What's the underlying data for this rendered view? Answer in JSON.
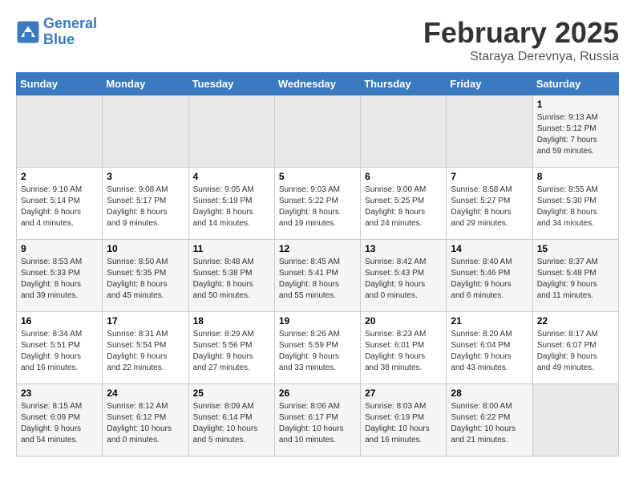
{
  "header": {
    "logo_line1": "General",
    "logo_line2": "Blue",
    "month": "February 2025",
    "location": "Staraya Derevnya, Russia"
  },
  "weekdays": [
    "Sunday",
    "Monday",
    "Tuesday",
    "Wednesday",
    "Thursday",
    "Friday",
    "Saturday"
  ],
  "weeks": [
    [
      {
        "day": "",
        "info": ""
      },
      {
        "day": "",
        "info": ""
      },
      {
        "day": "",
        "info": ""
      },
      {
        "day": "",
        "info": ""
      },
      {
        "day": "",
        "info": ""
      },
      {
        "day": "",
        "info": ""
      },
      {
        "day": "1",
        "info": "Sunrise: 9:13 AM\nSunset: 5:12 PM\nDaylight: 7 hours\nand 59 minutes."
      }
    ],
    [
      {
        "day": "2",
        "info": "Sunrise: 9:10 AM\nSunset: 5:14 PM\nDaylight: 8 hours\nand 4 minutes."
      },
      {
        "day": "3",
        "info": "Sunrise: 9:08 AM\nSunset: 5:17 PM\nDaylight: 8 hours\nand 9 minutes."
      },
      {
        "day": "4",
        "info": "Sunrise: 9:05 AM\nSunset: 5:19 PM\nDaylight: 8 hours\nand 14 minutes."
      },
      {
        "day": "5",
        "info": "Sunrise: 9:03 AM\nSunset: 5:22 PM\nDaylight: 8 hours\nand 19 minutes."
      },
      {
        "day": "6",
        "info": "Sunrise: 9:00 AM\nSunset: 5:25 PM\nDaylight: 8 hours\nand 24 minutes."
      },
      {
        "day": "7",
        "info": "Sunrise: 8:58 AM\nSunset: 5:27 PM\nDaylight: 8 hours\nand 29 minutes."
      },
      {
        "day": "8",
        "info": "Sunrise: 8:55 AM\nSunset: 5:30 PM\nDaylight: 8 hours\nand 34 minutes."
      }
    ],
    [
      {
        "day": "9",
        "info": "Sunrise: 8:53 AM\nSunset: 5:33 PM\nDaylight: 8 hours\nand 39 minutes."
      },
      {
        "day": "10",
        "info": "Sunrise: 8:50 AM\nSunset: 5:35 PM\nDaylight: 8 hours\nand 45 minutes."
      },
      {
        "day": "11",
        "info": "Sunrise: 8:48 AM\nSunset: 5:38 PM\nDaylight: 8 hours\nand 50 minutes."
      },
      {
        "day": "12",
        "info": "Sunrise: 8:45 AM\nSunset: 5:41 PM\nDaylight: 8 hours\nand 55 minutes."
      },
      {
        "day": "13",
        "info": "Sunrise: 8:42 AM\nSunset: 5:43 PM\nDaylight: 9 hours\nand 0 minutes."
      },
      {
        "day": "14",
        "info": "Sunrise: 8:40 AM\nSunset: 5:46 PM\nDaylight: 9 hours\nand 6 minutes."
      },
      {
        "day": "15",
        "info": "Sunrise: 8:37 AM\nSunset: 5:48 PM\nDaylight: 9 hours\nand 11 minutes."
      }
    ],
    [
      {
        "day": "16",
        "info": "Sunrise: 8:34 AM\nSunset: 5:51 PM\nDaylight: 9 hours\nand 16 minutes."
      },
      {
        "day": "17",
        "info": "Sunrise: 8:31 AM\nSunset: 5:54 PM\nDaylight: 9 hours\nand 22 minutes."
      },
      {
        "day": "18",
        "info": "Sunrise: 8:29 AM\nSunset: 5:56 PM\nDaylight: 9 hours\nand 27 minutes."
      },
      {
        "day": "19",
        "info": "Sunrise: 8:26 AM\nSunset: 5:59 PM\nDaylight: 9 hours\nand 33 minutes."
      },
      {
        "day": "20",
        "info": "Sunrise: 8:23 AM\nSunset: 6:01 PM\nDaylight: 9 hours\nand 38 minutes."
      },
      {
        "day": "21",
        "info": "Sunrise: 8:20 AM\nSunset: 6:04 PM\nDaylight: 9 hours\nand 43 minutes."
      },
      {
        "day": "22",
        "info": "Sunrise: 8:17 AM\nSunset: 6:07 PM\nDaylight: 9 hours\nand 49 minutes."
      }
    ],
    [
      {
        "day": "23",
        "info": "Sunrise: 8:15 AM\nSunset: 6:09 PM\nDaylight: 9 hours\nand 54 minutes."
      },
      {
        "day": "24",
        "info": "Sunrise: 8:12 AM\nSunset: 6:12 PM\nDaylight: 10 hours\nand 0 minutes."
      },
      {
        "day": "25",
        "info": "Sunrise: 8:09 AM\nSunset: 6:14 PM\nDaylight: 10 hours\nand 5 minutes."
      },
      {
        "day": "26",
        "info": "Sunrise: 8:06 AM\nSunset: 6:17 PM\nDaylight: 10 hours\nand 10 minutes."
      },
      {
        "day": "27",
        "info": "Sunrise: 8:03 AM\nSunset: 6:19 PM\nDaylight: 10 hours\nand 16 minutes."
      },
      {
        "day": "28",
        "info": "Sunrise: 8:00 AM\nSunset: 6:22 PM\nDaylight: 10 hours\nand 21 minutes."
      },
      {
        "day": "",
        "info": ""
      }
    ]
  ]
}
